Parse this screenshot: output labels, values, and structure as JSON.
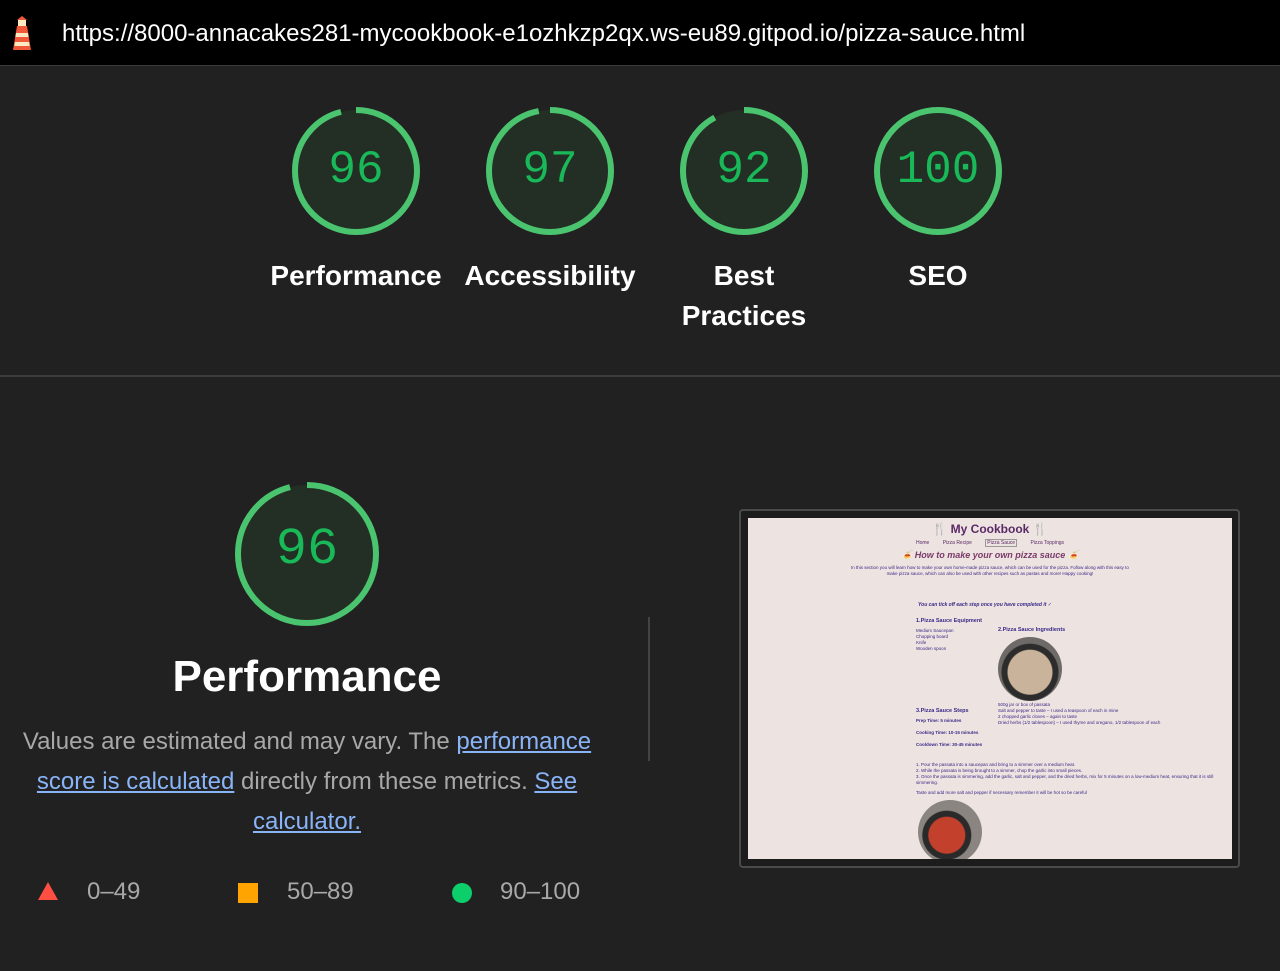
{
  "browser": {
    "url": "https://8000-annacakes281-mycookbook-e1ozhkzp2qx.ws-eu89.gitpod.io/pizza-sauce.html",
    "logo_icon": "lighthouse-icon"
  },
  "scores": [
    {
      "label": "Performance",
      "value": "96",
      "fraction": 0.96
    },
    {
      "label": "Accessibility",
      "value": "97",
      "fraction": 0.97
    },
    {
      "label": "Best Practices",
      "value": "92",
      "fraction": 0.92
    },
    {
      "label": "SEO",
      "value": "100",
      "fraction": 1.0
    }
  ],
  "detail": {
    "score": "96",
    "score_fraction": 0.96,
    "title": "Performance",
    "desc_prefix": "Values are estimated and may vary. The ",
    "desc_link1": "performance score is calculated",
    "desc_middle": " directly from these metrics. ",
    "desc_link2": "See calculator."
  },
  "legend": [
    {
      "range": "0–49",
      "icon": "triangle-icon",
      "color": "#ff4e42"
    },
    {
      "range": "50–89",
      "icon": "square-icon",
      "color": "#ffa400"
    },
    {
      "range": "90–100",
      "icon": "circle-icon",
      "color": "#0cce6b"
    }
  ],
  "screenshot": {
    "title": "🍴 My Cookbook 🍴",
    "nav": [
      "Home",
      "Pizza Recipe",
      "Pizza Sauce",
      "Pizza Toppings"
    ],
    "subtitle": "🍝 How to make your own pizza sauce 🍝",
    "intro": "In this section you will learn how to make your own home-made pizza sauce, which can be used for the pizza. Follow along with this easy to make pizza sauce, which can also be used with other recipes such as pastas and more! Happy cooking!",
    "note": "You can tick off each step once you have completed it ✓",
    "equipment_heading": "1.Pizza Sauce Equipment",
    "equipment": [
      "Medium Saucepan",
      "Chopping board",
      "Knife",
      "Wooden spoon"
    ],
    "ingredients_heading": "2.Pizza Sauce Ingredients",
    "ingredients": [
      "500g jar or box of passata",
      "Salt and pepper to taste – I used a teaspoon of each in mine",
      "2 chopped garlic cloves – again to taste",
      "Dried herbs (1/2 tablespoon) – I used thyme and oregano, 1/2 tablespoon of each"
    ],
    "steps_heading": "3.Pizza Sauce Steps",
    "times": [
      "Prep Time: 5 minutes",
      "Cooking Time: 10-15 minutes",
      "Cooldown Time: 30-45 minutes"
    ],
    "steps": [
      "1. Pour the passata into a saucepan and bring to a simmer over a medium heat.",
      "2. While the passata is being brought to a simmer, chop the garlic into small pieces.",
      "3. Once the passata is simmering, add the garlic, salt and pepper, and the dried herbs, mix for 5 minutes on a low-medium heat, ensuring that it is still simmering.",
      "Taste and add more salt and pepper if necessary remember it will be hot so be careful"
    ]
  }
}
